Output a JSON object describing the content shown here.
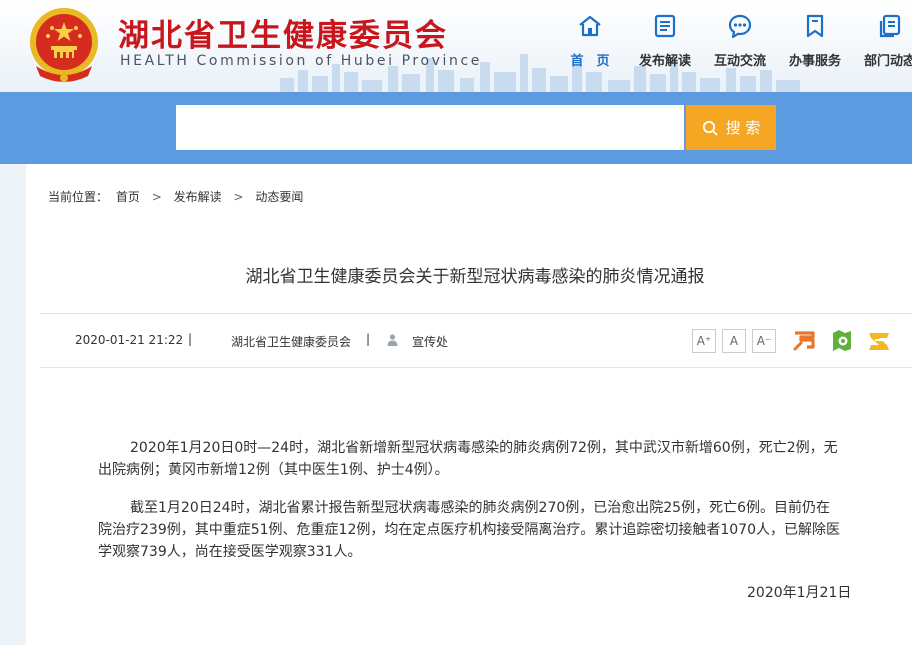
{
  "header": {
    "title": "湖北省卫生健康委员会",
    "subtitle": "HEALTH Commission of Hubei Province"
  },
  "nav": {
    "items": [
      {
        "label": "首　页",
        "icon": "home-icon",
        "active": true
      },
      {
        "label": "发布解读",
        "icon": "document-icon",
        "active": false
      },
      {
        "label": "互动交流",
        "icon": "chat-icon",
        "active": false
      },
      {
        "label": "办事服务",
        "icon": "bookmark-icon",
        "active": false
      },
      {
        "label": "部门动态",
        "icon": "copy-icon",
        "active": false
      }
    ]
  },
  "search": {
    "placeholder": "",
    "button_label": "搜 索"
  },
  "breadcrumb": {
    "prefix": "当前位置：",
    "items": [
      "首页",
      "发布解读",
      "动态要闻"
    ]
  },
  "article": {
    "title": "湖北省卫生健康委员会关于新型冠状病毒感染的肺炎情况通报",
    "date": "2020-01-21 21:22",
    "source": "湖北省卫生健康委员会",
    "author": "宣传处",
    "font_sizes": [
      "A⁺",
      "A",
      "A⁻"
    ],
    "paragraphs": [
      "2020年1月20日0时—24时，湖北省新增新型冠状病毒感染的肺炎病例72例，其中武汉市新增60例，死亡2例，无出院病例；黄冈市新增12例（其中医生1例、护士4例）。",
      "截至1月20日24时，湖北省累计报告新型冠状病毒感染的肺炎病例270例，已治愈出院25例，死亡6例。目前仍在院治疗239例，其中重症51例、危重症12例，均在定点医疗机构接受隔离治疗。累计追踪密切接触者1070人，已解除医学观察739人，尚在接受医学观察331人。"
    ],
    "sign_date": "2020年1月21日"
  },
  "share": {
    "icons": [
      "weibo-share-icon",
      "wechat-share-icon",
      "qzone-share-icon"
    ]
  },
  "colors": {
    "brand_red": "#c8161d",
    "band_blue": "#5d9be0",
    "search_orange": "#f5a623",
    "nav_active": "#1e6fc9"
  }
}
